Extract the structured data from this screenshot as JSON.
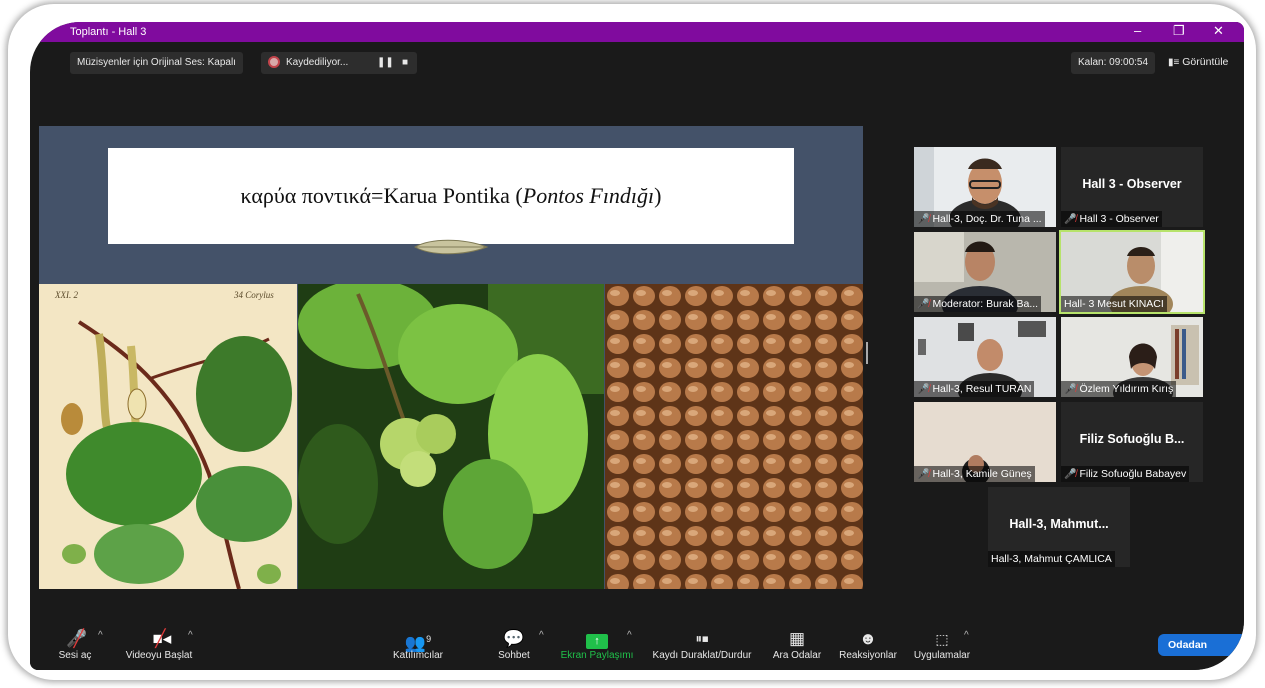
{
  "window": {
    "title": "Toplantı - Hall 3",
    "controls": {
      "minimize": "–",
      "restore": "❐",
      "close": "✕"
    }
  },
  "top_bar": {
    "original_sound": "Müzisyenler için Orijinal Ses: Kapalı",
    "recording": "Kaydediliyor...",
    "time_left": "Kalan: 09:00:54",
    "view": "Görüntüle"
  },
  "slide": {
    "title_greek": "καρύα ποντικά=Karua Pontika (",
    "title_italic": "Pontos Fındığı",
    "title_end": ")",
    "herbarium_tl": "XXI. 2",
    "herbarium_tr": "34 Corylus"
  },
  "participants": [
    {
      "name": "Hall-3, Doç. Dr. Tuna ...",
      "muted": true,
      "video": true
    },
    {
      "name": "Hall 3 - Observer",
      "display": "Hall 3 - Observer",
      "muted": true,
      "video": false
    },
    {
      "name": "Moderator: Burak Ba...",
      "muted": true,
      "video": true
    },
    {
      "name": "Hall- 3 Mesut KINACI",
      "muted": false,
      "video": true,
      "active": true
    },
    {
      "name": "Hall-3, Resul TURAN",
      "muted": true,
      "video": true
    },
    {
      "name": "Özlem Yıldırım Kırış",
      "muted": true,
      "video": true
    },
    {
      "name": "Hall-3, Kamile Güneş",
      "muted": true,
      "video": true
    },
    {
      "name": "Filiz Sofuoğlu Babayev",
      "display": "Filiz Sofuoğlu B...",
      "muted": true,
      "video": false
    },
    {
      "name": "Hall-3, Mahmut ÇAMLICA",
      "display": "Hall-3, Mahmut...",
      "muted": false,
      "video": false
    }
  ],
  "toolbar": {
    "mute": "Sesi aç",
    "video": "Videoyu Başlat",
    "participants": "Katılımcılar",
    "participants_count": "9",
    "chat": "Sohbet",
    "share": "Ekran Paylaşımı",
    "pause_record": "Kaydı Duraklat/Durdur",
    "breakout": "Ara Odalar",
    "reactions": "Reaksiyonlar",
    "apps": "Uygulamalar",
    "leave": "Odadan"
  },
  "colors": {
    "titlebar": "#800b9e",
    "share_green": "#20c04a",
    "leave_blue": "#1a6fd6",
    "active_border": "#b7e36b",
    "muted_red": "#e23b3b"
  }
}
